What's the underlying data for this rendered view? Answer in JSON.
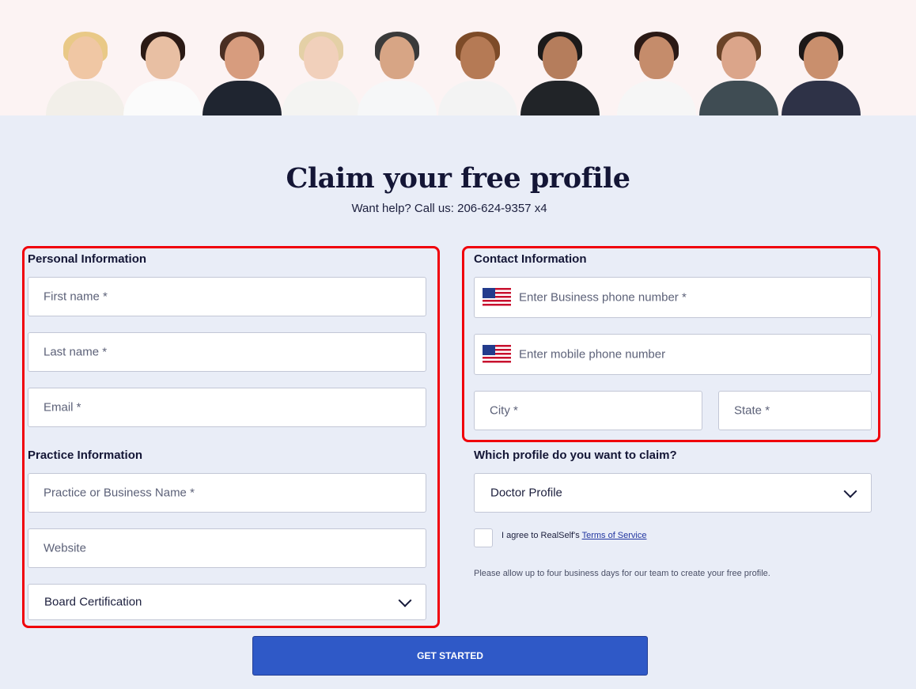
{
  "header": {
    "title": "Claim your free profile",
    "help_text": "Want help? Call us: 206-624-9357 x4"
  },
  "personal": {
    "heading": "Personal Information",
    "first_name_placeholder": "First name *",
    "last_name_placeholder": "Last name *",
    "email_placeholder": "Email *"
  },
  "practice": {
    "heading": "Practice Information",
    "business_placeholder": "Practice or Business Name *",
    "website_placeholder": "Website",
    "board_certification": "Board Certification"
  },
  "contact": {
    "heading": "Contact Information",
    "business_phone_placeholder": "Enter Business phone number *",
    "mobile_phone_placeholder": "Enter mobile phone number",
    "city_placeholder": "City *",
    "state_placeholder": "State *",
    "flag_icon": "us-flag-icon"
  },
  "profile": {
    "heading": "Which profile do you want to claim?",
    "selected": "Doctor Profile"
  },
  "terms": {
    "prefix": "I agree to RealSelf's",
    "link": "Terms of Service"
  },
  "note": "Please allow up to four business days for our team to create your free profile.",
  "submit_label": "GET STARTED",
  "colors": {
    "page_bg": "#e9edf7",
    "hero_bg": "#fcf3f3",
    "highlight": "#f0000b",
    "button": "#2f59c7",
    "title": "#141636"
  }
}
